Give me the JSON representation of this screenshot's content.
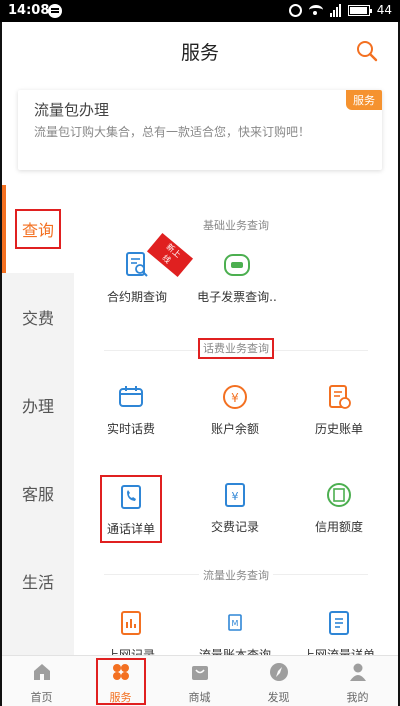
{
  "status_bar": {
    "time": "14:08",
    "battery": "44"
  },
  "header": {
    "title": "服务"
  },
  "banner": {
    "title": "流量包办理",
    "desc": "流量包订购大集合，总有一款适合您，快来订购吧！",
    "badge": "服务"
  },
  "sidenav": {
    "items": [
      {
        "label": "查询",
        "active": true
      },
      {
        "label": "交费"
      },
      {
        "label": "办理"
      },
      {
        "label": "客服"
      },
      {
        "label": "生活"
      }
    ]
  },
  "sections": [
    {
      "title": "基础业务查询",
      "tiles": [
        {
          "label": "合约期查询",
          "icon": "contract-search-icon",
          "ribbon": "新上线"
        },
        {
          "label": "电子发票查询..",
          "icon": "invoice-icon"
        }
      ]
    },
    {
      "title": "话费业务查询",
      "tiles": [
        {
          "label": "实时话费",
          "icon": "wallet-icon"
        },
        {
          "label": "账户余额",
          "icon": "yen-coin-icon"
        },
        {
          "label": "历史账单",
          "icon": "history-bill-icon"
        },
        {
          "label": "通话详单",
          "icon": "call-detail-icon"
        },
        {
          "label": "交费记录",
          "icon": "payment-record-icon"
        },
        {
          "label": "信用额度",
          "icon": "credit-icon"
        }
      ]
    },
    {
      "title": "流量业务查询",
      "tiles": [
        {
          "label": "上网记录",
          "icon": "data-record-icon"
        },
        {
          "label": "流量账本查询",
          "icon": "data-ledger-icon"
        },
        {
          "label": "上网流量详单",
          "icon": "data-detail-icon"
        }
      ]
    }
  ],
  "tabbar": {
    "items": [
      {
        "label": "首页",
        "icon": "home-icon"
      },
      {
        "label": "服务",
        "icon": "service-icon",
        "active": true
      },
      {
        "label": "商城",
        "icon": "shopping-bag-icon"
      },
      {
        "label": "发现",
        "icon": "compass-icon"
      },
      {
        "label": "我的",
        "icon": "user-icon"
      }
    ]
  },
  "colors": {
    "accent": "#f37021",
    "highlight": "#e02020",
    "blue": "#2f86d6",
    "green": "#4caf50"
  }
}
